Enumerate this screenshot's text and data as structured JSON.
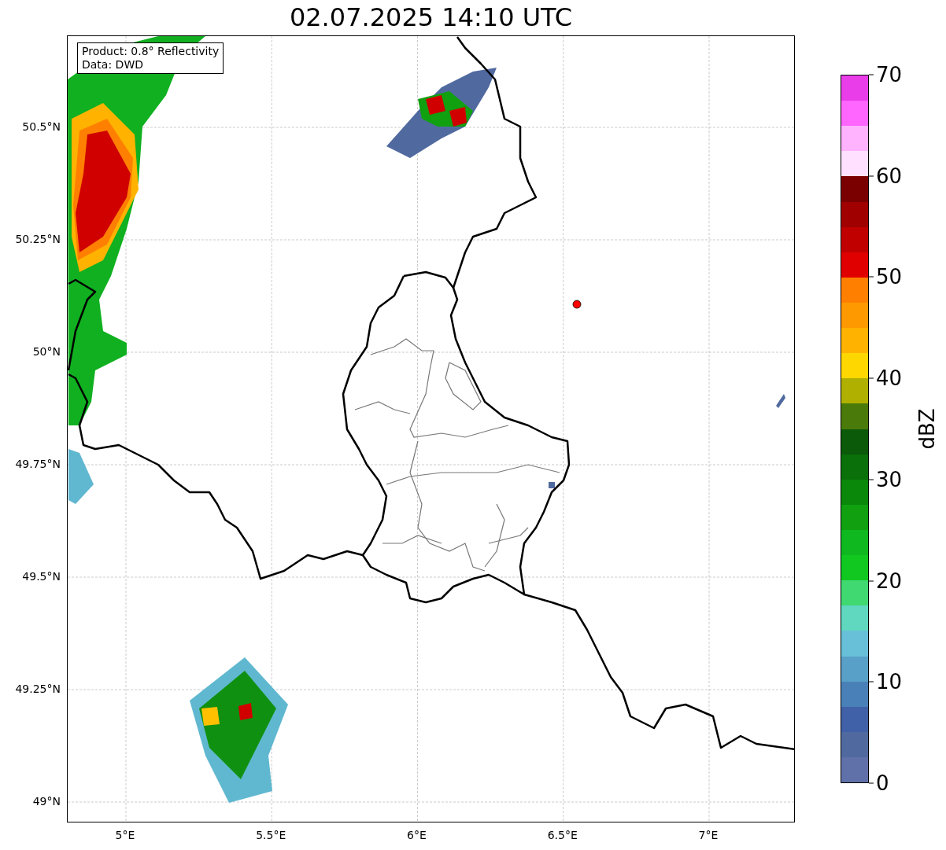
{
  "title": "02.07.2025 14:10 UTC",
  "info_box": [
    "Product: 0.8° Reflectivity",
    "Data: DWD"
  ],
  "map": {
    "yticks": [
      "50.5°N",
      "50.25°N",
      "50°N",
      "49.75°N",
      "49.5°N",
      "49.25°N",
      "49°N"
    ],
    "xticks": [
      "5°E",
      "5.5°E",
      "6°E",
      "6.5°E",
      "7°E"
    ],
    "marker": {
      "color": "#ff0000"
    }
  },
  "colorbar": {
    "label": "dBZ",
    "ticks": [
      "70",
      "60",
      "50",
      "40",
      "30",
      "20",
      "10",
      "0"
    ],
    "bands": [
      {
        "color": "#e83de8"
      },
      {
        "color": "#ff66ff"
      },
      {
        "color": "#ffb3ff"
      },
      {
        "color": "#ffe0ff"
      },
      {
        "color": "#7a0000"
      },
      {
        "color": "#a00000"
      },
      {
        "color": "#c00000"
      },
      {
        "color": "#e00000"
      },
      {
        "color": "#ff8000"
      },
      {
        "color": "#ff9900"
      },
      {
        "color": "#ffb300"
      },
      {
        "color": "#ffd700"
      },
      {
        "color": "#b0b000"
      },
      {
        "color": "#4a7a0a"
      },
      {
        "color": "#0a5a0a"
      },
      {
        "color": "#0a700a"
      },
      {
        "color": "#0a880a"
      },
      {
        "color": "#10a010"
      },
      {
        "color": "#10b820"
      },
      {
        "color": "#10c820"
      },
      {
        "color": "#40d870"
      },
      {
        "color": "#60d8c0"
      },
      {
        "color": "#68c0d8"
      },
      {
        "color": "#58a0c8"
      },
      {
        "color": "#4a80b8"
      },
      {
        "color": "#4060a8"
      },
      {
        "color": "#506aa0"
      },
      {
        "color": "#6070a8"
      }
    ]
  }
}
